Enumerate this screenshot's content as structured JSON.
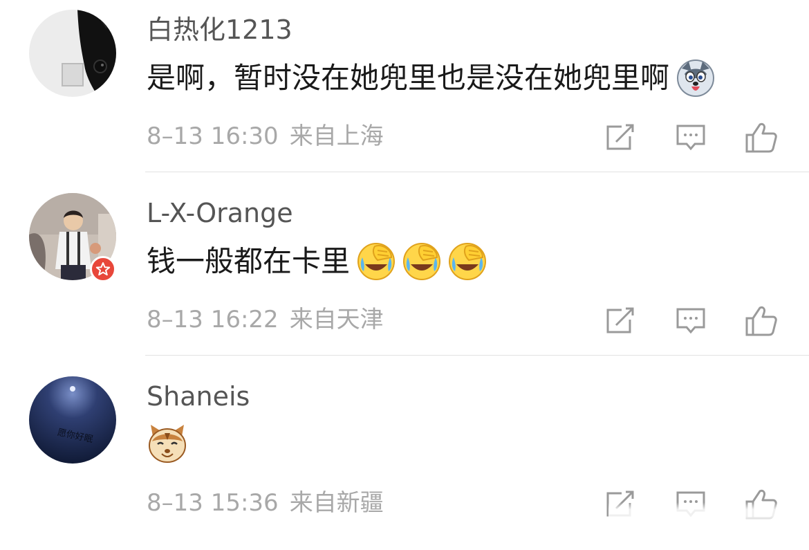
{
  "comments": [
    {
      "username": "白热化1213",
      "text": "是啊，暂时没在她兜里也是没在她兜里啊",
      "emojis": [
        "husky-emoji"
      ],
      "time": "8–13 16:30",
      "location": "来自上海",
      "avatar": "black-cat-avatar"
    },
    {
      "username": "L-X-Orange",
      "text": "钱一般都在卡里",
      "emojis": [
        "laugh-cry-emoji",
        "laugh-cry-emoji",
        "laugh-cry-emoji"
      ],
      "time": "8–13 16:22",
      "location": "来自天津",
      "avatar": "child-photo-avatar",
      "badge": "star-badge"
    },
    {
      "username": "Shaneis",
      "text": "",
      "emojis": [
        "cat-face-emoji"
      ],
      "time": "8–13 15:36",
      "location": "来自新疆",
      "avatar": "dark-sphere-avatar",
      "avatar_text": "愿你好眠"
    }
  ],
  "actions": [
    "repost-icon",
    "reply-icon",
    "like-icon"
  ],
  "colors": {
    "username": "#555555",
    "meta": "#a8a8a8",
    "divider": "#e2e2e2",
    "badge": "#e8473a",
    "icon": "#9a9a9a"
  }
}
